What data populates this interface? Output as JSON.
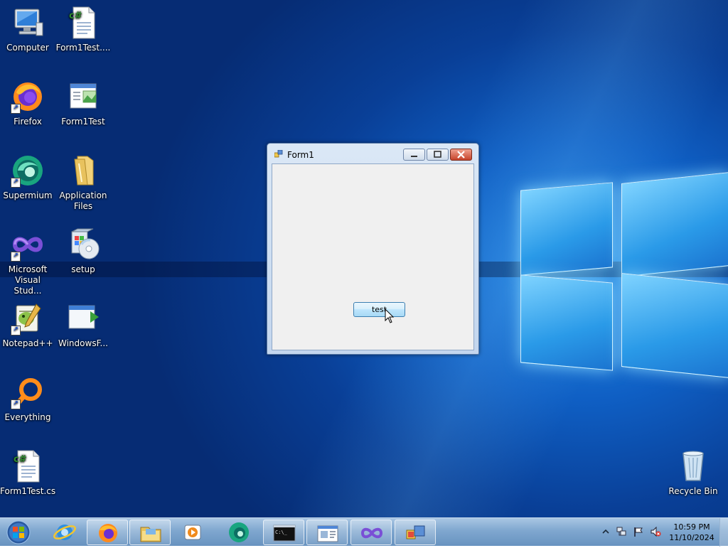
{
  "desktop": {
    "icons": [
      {
        "label": "Computer"
      },
      {
        "label": "Form1Test...."
      },
      {
        "label": "Firefox"
      },
      {
        "label": "Form1Test"
      },
      {
        "label": "Supermium"
      },
      {
        "label": "Application Files"
      },
      {
        "label": "Microsoft Visual Stud..."
      },
      {
        "label": "setup"
      },
      {
        "label": "Notepad++"
      },
      {
        "label": "WindowsF..."
      },
      {
        "label": "Everything"
      },
      {
        "label": "Form1Test.cs"
      },
      {
        "label": "Recycle Bin"
      }
    ]
  },
  "window": {
    "title": "Form1",
    "button_label": "test"
  },
  "taskbar": {
    "items": [
      "start-orb",
      "internet-explorer",
      "firefox",
      "file-explorer",
      "media-player",
      "supermium",
      "command-prompt",
      "windows-forms-app",
      "visual-studio",
      "form1-app"
    ],
    "clock": {
      "time": "10:59 PM",
      "date": "11/10/2024"
    }
  },
  "colors": {
    "accent": "#0f5fc4",
    "taskbar": "#7fa7cf",
    "close_button": "#c6432a"
  }
}
